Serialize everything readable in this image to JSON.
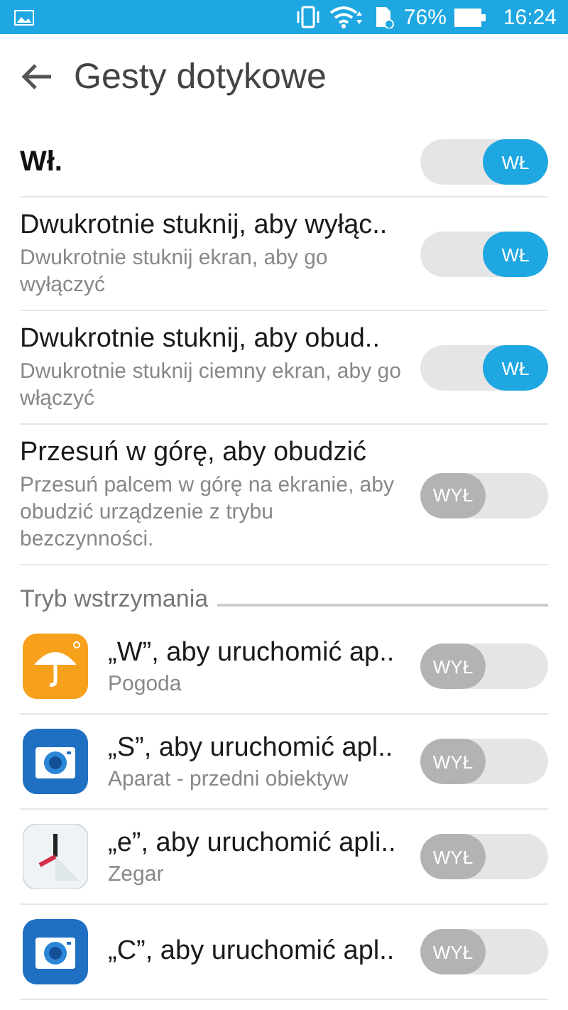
{
  "status_bar": {
    "battery": "76%",
    "time": "16:24"
  },
  "header": {
    "title": "Gesty dotykowe"
  },
  "master": {
    "label": "Wł.",
    "on": true,
    "toggle_label": "WŁ"
  },
  "settings": [
    {
      "title": "Dwukrotnie stuknij, aby wyłąc..",
      "description": "Dwukrotnie stuknij ekran, aby go wyłączyć",
      "on": true,
      "toggle_label": "WŁ"
    },
    {
      "title": "Dwukrotnie stuknij, aby obud..",
      "description": "Dwukrotnie stuknij ciemny ekran, aby go włączyć",
      "on": true,
      "toggle_label": "WŁ"
    },
    {
      "title": "Przesuń w górę, aby obudzić",
      "description": "Przesuń palcem w górę na ekranie, aby obudzić urządzenie z trybu bezczynności.",
      "on": false,
      "toggle_label": "WYŁ"
    }
  ],
  "section": {
    "title": "Tryb wstrzymania",
    "items": [
      {
        "kind": "weather",
        "title": "„W”, aby uruchomić ap..",
        "subtitle": "Pogoda",
        "on": false,
        "toggle_label": "WYŁ"
      },
      {
        "kind": "camera",
        "title": "„S”, aby uruchomić apl..",
        "subtitle": "Aparat - przedni obiektyw",
        "on": false,
        "toggle_label": "WYŁ"
      },
      {
        "kind": "clock",
        "title": "„e”, aby uruchomić apli..",
        "subtitle": "Zegar",
        "on": false,
        "toggle_label": "WYŁ"
      },
      {
        "kind": "camera",
        "title": "„C”, aby uruchomić apl..",
        "on": false,
        "toggle_label": "WYŁ"
      }
    ]
  }
}
